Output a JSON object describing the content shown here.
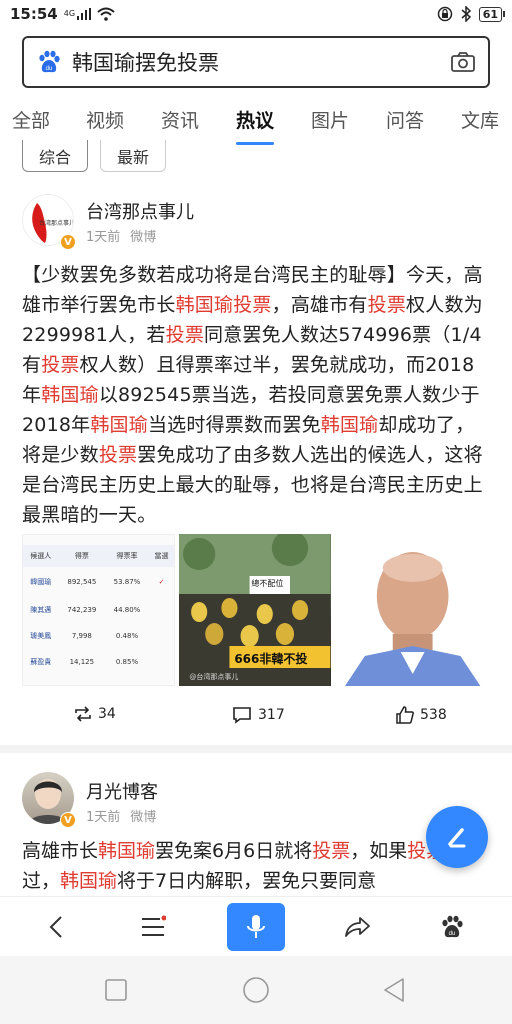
{
  "status": {
    "time": "15:54",
    "network": "4G",
    "battery": "61"
  },
  "search": {
    "query": "韩国瑜摆免投票"
  },
  "tabs": [
    "全部",
    "视频",
    "资讯",
    "热议",
    "图片",
    "问答",
    "文库"
  ],
  "active_tab": "热议",
  "filters": [
    "综合",
    "最新"
  ],
  "post1": {
    "author": "台湾那点事儿",
    "avatar_text": "台湾那点事儿",
    "time": "1天前",
    "source": "微博",
    "content_parts": [
      {
        "t": "【少数罢免多数若成功将是台湾民主的耻辱】今天，高雄市举行罢免市长",
        "h": false
      },
      {
        "t": "韩国瑜投票",
        "h": true
      },
      {
        "t": "，高雄市有",
        "h": false
      },
      {
        "t": "投票",
        "h": true
      },
      {
        "t": "权人数为2299981人，若",
        "h": false
      },
      {
        "t": "投票",
        "h": true
      },
      {
        "t": "同意罢免人数达574996票（1/4有",
        "h": false
      },
      {
        "t": "投票",
        "h": true
      },
      {
        "t": "权人数）且得票率过半，罢免就成功，而2018年",
        "h": false
      },
      {
        "t": "韩国瑜",
        "h": true
      },
      {
        "t": "以892545票当选，若投同意罢免票人数少于2018年",
        "h": false
      },
      {
        "t": "韩国瑜",
        "h": true
      },
      {
        "t": "当选时得票数而罢免",
        "h": false
      },
      {
        "t": "韩国瑜",
        "h": true
      },
      {
        "t": "却成功了，将是少数",
        "h": false
      },
      {
        "t": "投票",
        "h": true
      },
      {
        "t": "罢免成功了由多数人选出的候选人，这将是台湾民主历史上最大的耻辱，也将是台湾民主历史上最黑暗的一天。",
        "h": false
      }
    ],
    "table": {
      "headers": [
        "候選人",
        "得票",
        "得票率",
        "當選"
      ],
      "rows": [
        [
          "韓國瑜",
          "892,545",
          "53.87%",
          "✓"
        ],
        [
          "陳其邁",
          "742,239",
          "44.80%",
          ""
        ],
        [
          "璩美鳳",
          "7,998",
          "0.48%",
          ""
        ],
        [
          "蘇盈貴",
          "14,125",
          "0.85%",
          ""
        ]
      ]
    },
    "image2_text": "666非韓不投",
    "image2_sign": "總不配位",
    "image2_watermark": "@台湾那点事儿",
    "reposts": "34",
    "comments": "317",
    "likes": "538"
  },
  "post2": {
    "author": "月光博客",
    "time": "1天前",
    "source": "微博",
    "content_parts": [
      {
        "t": "高雄市长",
        "h": false
      },
      {
        "t": "韩国瑜",
        "h": true
      },
      {
        "t": "罢免案6月6日就将",
        "h": false
      },
      {
        "t": "投票",
        "h": true
      },
      {
        "t": "，如果",
        "h": false
      },
      {
        "t": "投票",
        "h": true
      },
      {
        "t": "通过，",
        "h": false
      },
      {
        "t": "韩国瑜",
        "h": true
      },
      {
        "t": "将于7日内解职，罢免只要同意",
        "h": false
      }
    ]
  },
  "colors": {
    "accent": "#3388ff",
    "highlight": "#e03c31"
  }
}
